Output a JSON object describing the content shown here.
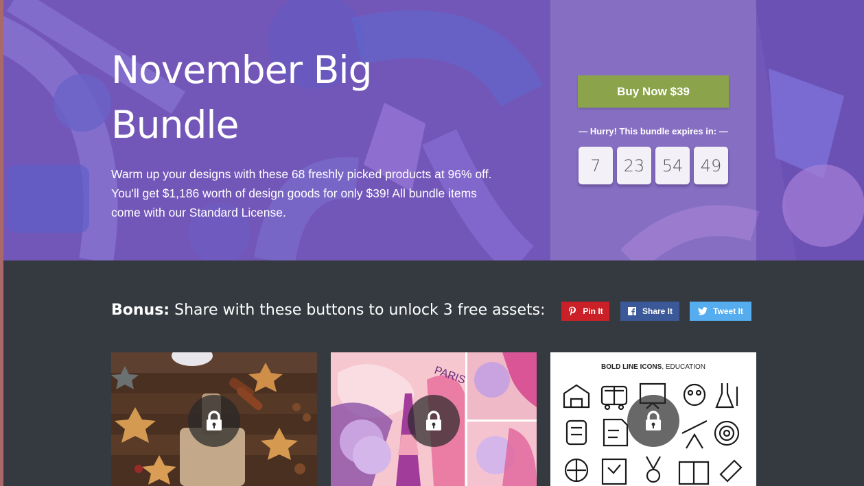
{
  "hero": {
    "title": "November Big Bundle",
    "description": "Warm up your designs with these 68 freshly picked products at 96% off. You'll get $1,186 worth of design goods for only $39! All bundle items come with our Standard License."
  },
  "purchase": {
    "buy_label": "Buy Now $39",
    "expiry_text": "— Hurry! This bundle expires in: —",
    "countdown": [
      "7",
      "23",
      "54",
      "49"
    ]
  },
  "bonus": {
    "lead": "Bonus:",
    "text": " Share with these buttons to unlock 3 free assets:"
  },
  "share_buttons": {
    "pinterest": "Pin It",
    "facebook": "Share It",
    "twitter": "Tweet It"
  },
  "assets": [
    {
      "name": "Baking cookies photo",
      "locked": true
    },
    {
      "name": "Paris illustrations",
      "locked": true
    },
    {
      "name": "Bold line icons, education",
      "locked": true,
      "title_bold": "BOLD LINE ICONS",
      "title_rest": ", EDUCATION"
    }
  ],
  "colors": {
    "hero_bg": "#7357b8",
    "dark_bg": "#343a40",
    "buy_button": "#8ba34b",
    "pinterest": "#cb2027",
    "facebook": "#3b5998",
    "twitter": "#55acee"
  },
  "icons": [
    "pinterest-icon",
    "facebook-icon",
    "twitter-icon",
    "lock-icon"
  ]
}
